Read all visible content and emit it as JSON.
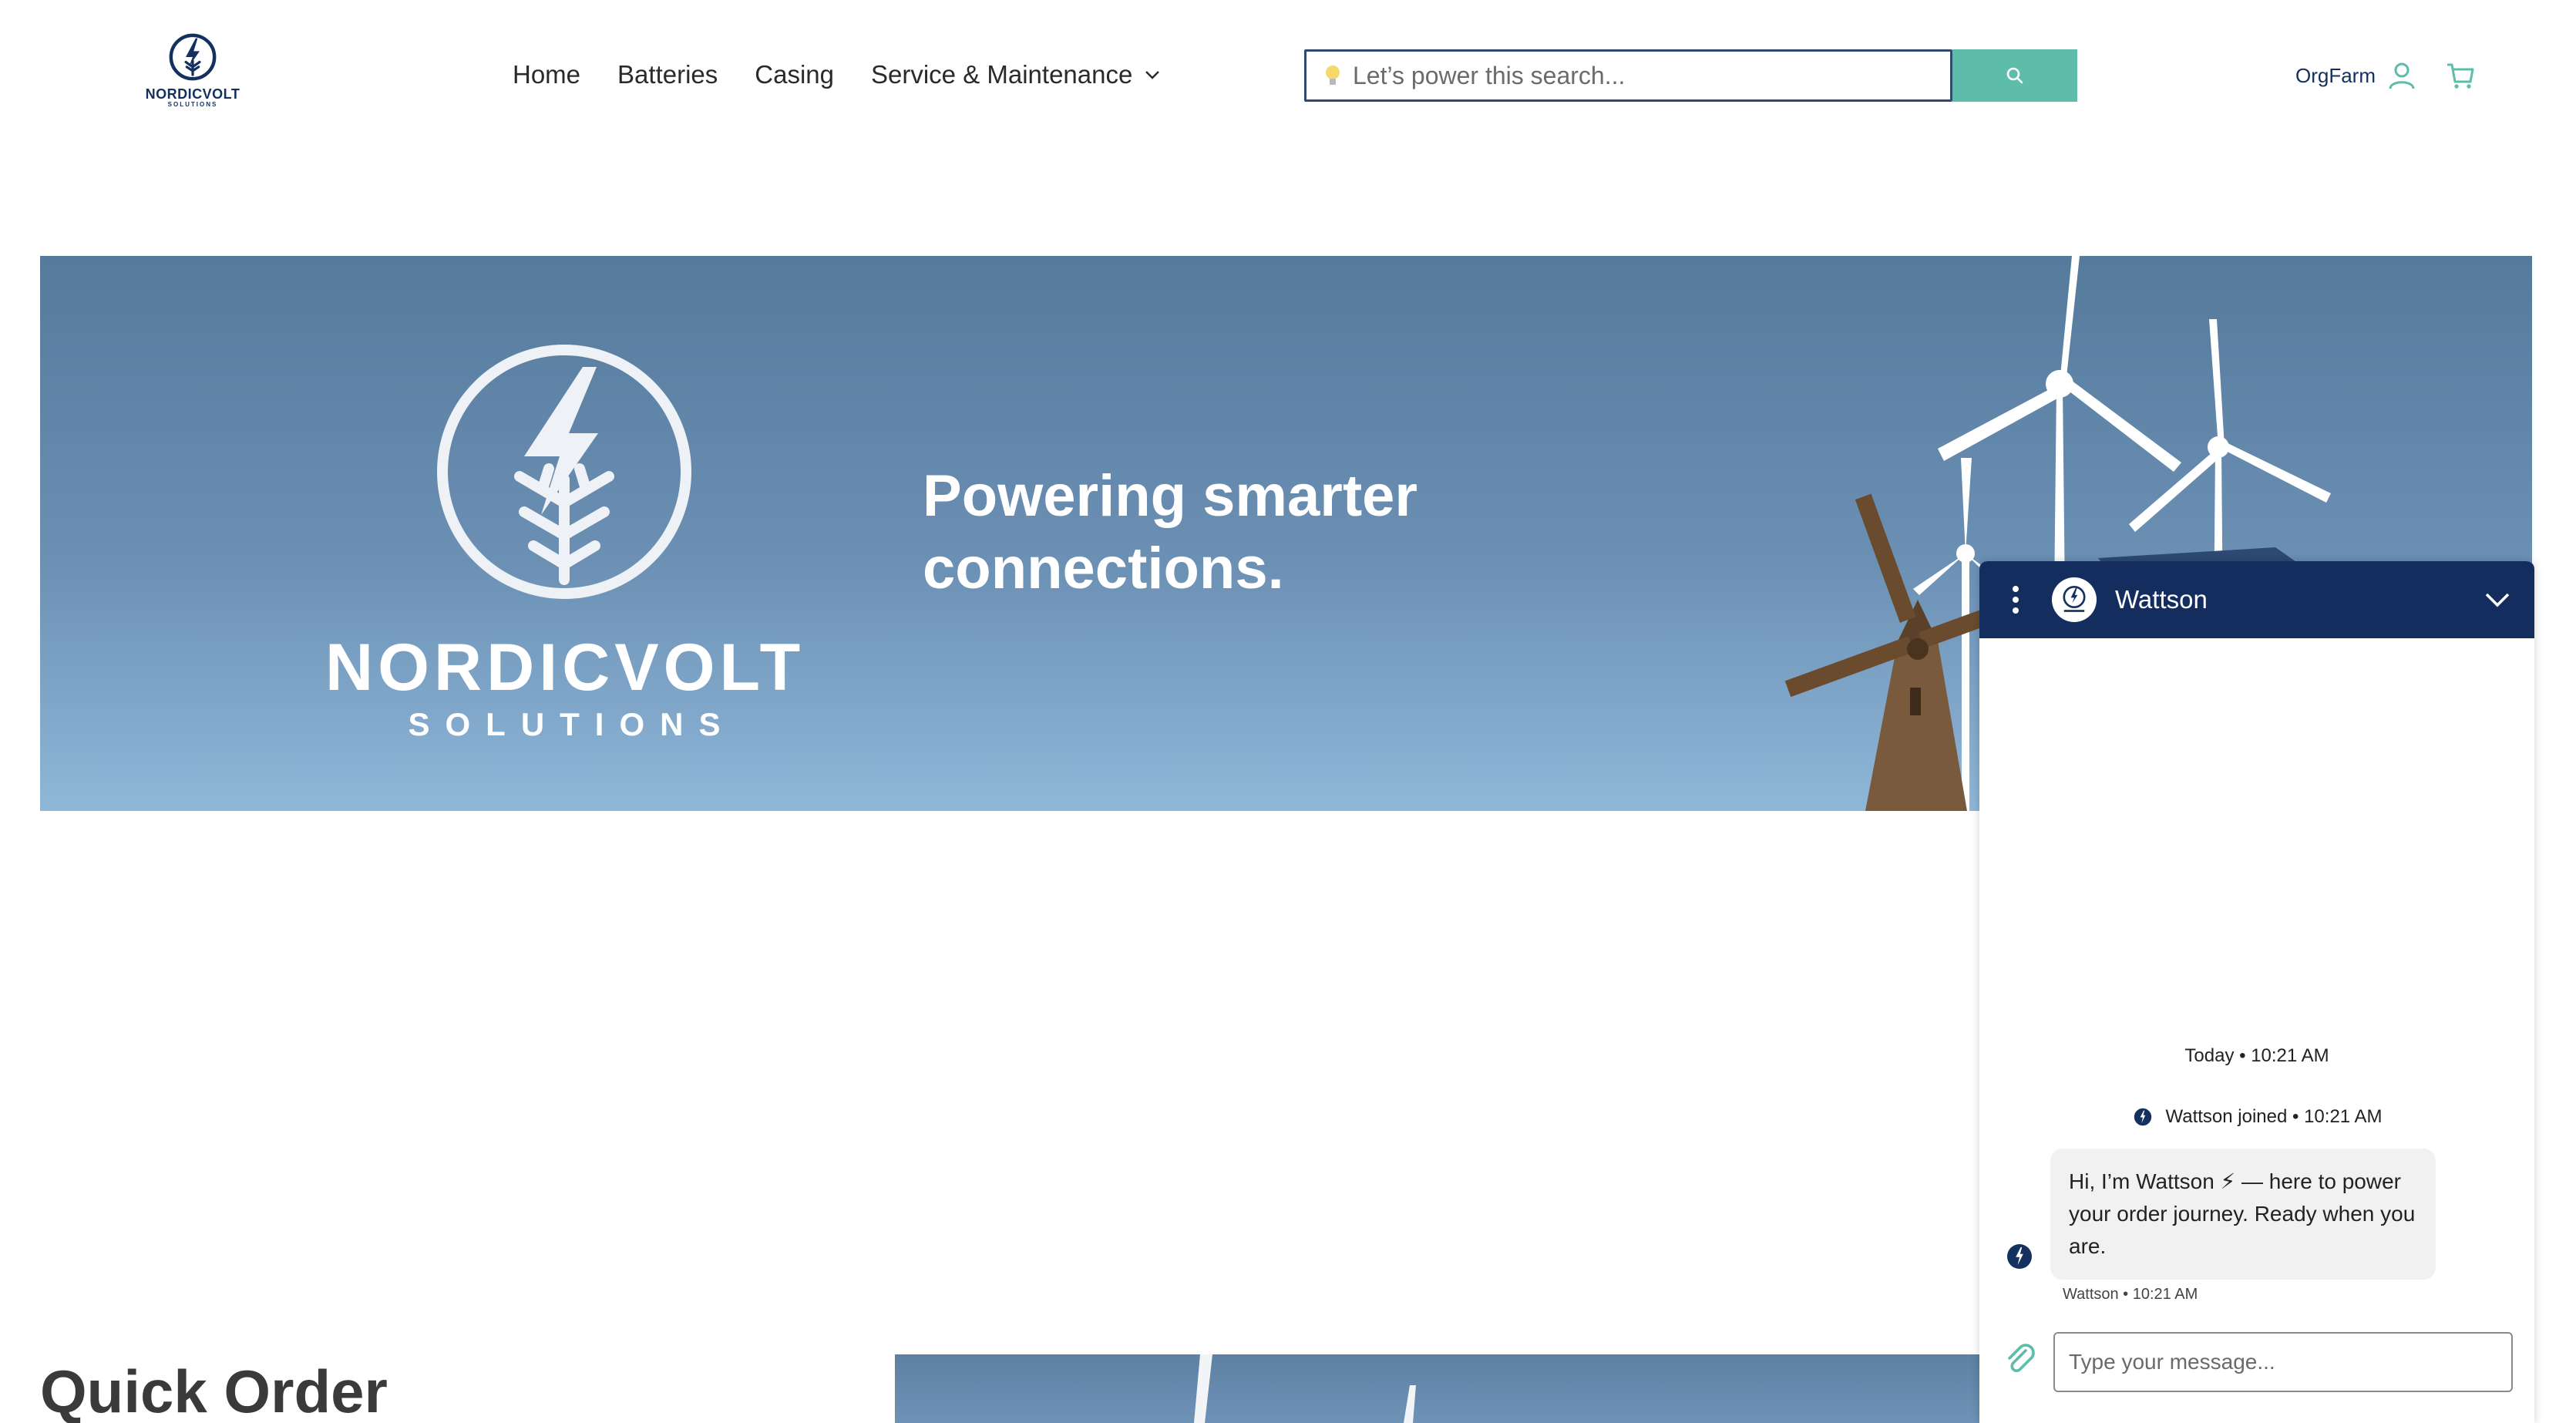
{
  "header": {
    "logo": {
      "name": "NORDICVOLT",
      "sub": "SOLUTIONS"
    },
    "nav": [
      {
        "label": "Home"
      },
      {
        "label": "Batteries"
      },
      {
        "label": "Casing"
      },
      {
        "label": "Service & Maintenance",
        "has_dropdown": true
      }
    ],
    "search": {
      "placeholder": "Let’s power this search..."
    },
    "user": {
      "name": "OrgFarm"
    }
  },
  "hero": {
    "logo": {
      "name": "NORDICVOLT",
      "sub": "SOLUTIONS"
    },
    "tagline": "Powering smarter connections."
  },
  "quick_order": {
    "title": "Quick Order"
  },
  "chat": {
    "title": "Wattson",
    "day_stamp": "Today • 10:21 AM",
    "join_notice": "Wattson joined • 10:21 AM",
    "message": "Hi, I’m Wattson ⚡ — here to power your order journey. Ready when you are.",
    "message_meta": "Wattson • 10:21 AM",
    "input_placeholder": "Type your message..."
  },
  "colors": {
    "brand_navy": "#132d5e",
    "accent_teal": "#5dbcaa",
    "hero_sky": "#6b90b4"
  },
  "icons": [
    "bolt-tree-logo-icon",
    "chevron-down-icon",
    "lightbulb-icon",
    "search-icon",
    "user-icon",
    "cart-icon",
    "kebab-menu-icon",
    "collapse-chevron-icon",
    "paperclip-icon"
  ]
}
